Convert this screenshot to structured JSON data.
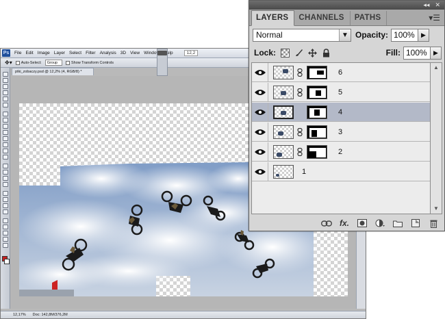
{
  "photoshop": {
    "logo": "Ps",
    "menu": [
      "File",
      "Edit",
      "Image",
      "Layer",
      "Select",
      "Filter",
      "Analysis",
      "3D",
      "View",
      "Window",
      "Help"
    ],
    "zoom_field": "12,2",
    "options": {
      "auto_select_label": "Auto-Select:",
      "auto_select_value": "Group",
      "transform_label": "Show Transform Controls"
    },
    "doc_tab": "ptki_zobaczy.psd @ 12,2% (4, RGB/8) *",
    "status": {
      "zoom": "12,17%",
      "doc": "Doc: 142,8M/376,2M"
    }
  },
  "layers_panel": {
    "tabs": [
      {
        "label": "LAYERS",
        "active": true
      },
      {
        "label": "CHANNELS",
        "active": false
      },
      {
        "label": "PATHS",
        "active": false
      }
    ],
    "top_controls": {
      "collapse": "◂◂",
      "close": "✕"
    },
    "menu_icon": "▾☰",
    "blend_mode": "Normal",
    "opacity_label": "Opacity:",
    "opacity_value": "100%",
    "lock_label": "Lock:",
    "fill_label": "Fill:",
    "fill_value": "100%",
    "layers": [
      {
        "name": "6",
        "selected": false,
        "has_mask": true
      },
      {
        "name": "5",
        "selected": false,
        "has_mask": true
      },
      {
        "name": "4",
        "selected": true,
        "has_mask": true
      },
      {
        "name": "3",
        "selected": false,
        "has_mask": true
      },
      {
        "name": "2",
        "selected": false,
        "has_mask": true
      },
      {
        "name": "1",
        "selected": false,
        "has_mask": false
      }
    ],
    "annotation_number": "1",
    "bottom_icons": [
      "link-layers-icon",
      "fx-icon",
      "add-mask-icon",
      "adjustment-layer-icon",
      "new-group-icon",
      "new-layer-icon",
      "trash-icon"
    ],
    "fx_label": "fx."
  }
}
